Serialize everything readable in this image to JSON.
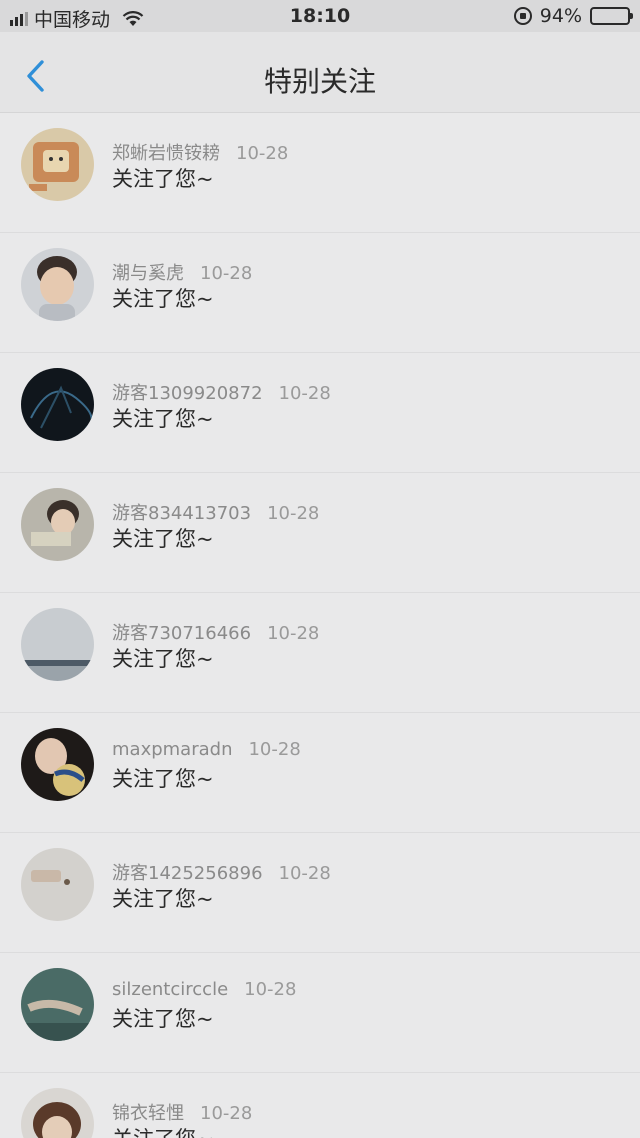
{
  "status_bar": {
    "carrier": "中国移动",
    "time": "18:10",
    "battery_pct": "94%"
  },
  "nav": {
    "title": "特别关注",
    "back_icon": "chevron-left-icon"
  },
  "notifications": [
    {
      "name": "郑蜥岩愦铵耪",
      "date": "10-28",
      "message": "关注了您~"
    },
    {
      "name": "潮与奚虎",
      "date": "10-28",
      "message": "关注了您~"
    },
    {
      "name": "游客1309920872",
      "date": "10-28",
      "message": "关注了您~"
    },
    {
      "name": "游客834413703",
      "date": "10-28",
      "message": "关注了您~"
    },
    {
      "name": "游客730716466",
      "date": "10-28",
      "message": "关注了您~"
    },
    {
      "name": "maxpmaradn",
      "date": "10-28",
      "message": "关注了您~"
    },
    {
      "name": "游客1425256896",
      "date": "10-28",
      "message": "关注了您~"
    },
    {
      "name": "silzentcirccle",
      "date": "10-28",
      "message": "关注了您~"
    },
    {
      "name": "锦衣轻悝",
      "date": "10-28",
      "message": "关注了您~"
    }
  ],
  "colors": {
    "accent": "#2f8fd8",
    "overlay_bg": "#e9e9ea"
  }
}
